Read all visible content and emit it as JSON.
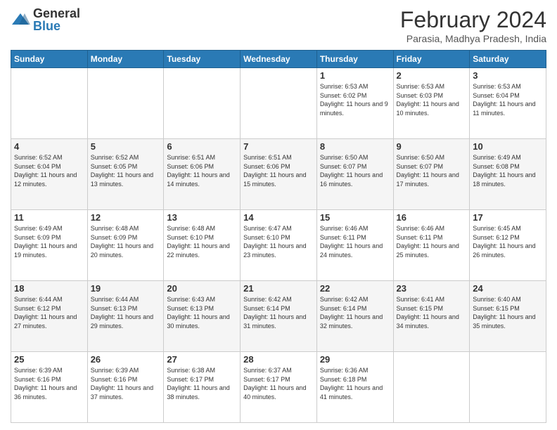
{
  "header": {
    "logo_general": "General",
    "logo_blue": "Blue",
    "month_title": "February 2024",
    "location": "Parasia, Madhya Pradesh, India"
  },
  "days_of_week": [
    "Sunday",
    "Monday",
    "Tuesday",
    "Wednesday",
    "Thursday",
    "Friday",
    "Saturday"
  ],
  "weeks": [
    [
      {
        "day": "",
        "sunrise": "",
        "sunset": "",
        "daylight": ""
      },
      {
        "day": "",
        "sunrise": "",
        "sunset": "",
        "daylight": ""
      },
      {
        "day": "",
        "sunrise": "",
        "sunset": "",
        "daylight": ""
      },
      {
        "day": "",
        "sunrise": "",
        "sunset": "",
        "daylight": ""
      },
      {
        "day": "1",
        "sunrise": "Sunrise: 6:53 AM",
        "sunset": "Sunset: 6:02 PM",
        "daylight": "Daylight: 11 hours and 9 minutes."
      },
      {
        "day": "2",
        "sunrise": "Sunrise: 6:53 AM",
        "sunset": "Sunset: 6:03 PM",
        "daylight": "Daylight: 11 hours and 10 minutes."
      },
      {
        "day": "3",
        "sunrise": "Sunrise: 6:53 AM",
        "sunset": "Sunset: 6:04 PM",
        "daylight": "Daylight: 11 hours and 11 minutes."
      }
    ],
    [
      {
        "day": "4",
        "sunrise": "Sunrise: 6:52 AM",
        "sunset": "Sunset: 6:04 PM",
        "daylight": "Daylight: 11 hours and 12 minutes."
      },
      {
        "day": "5",
        "sunrise": "Sunrise: 6:52 AM",
        "sunset": "Sunset: 6:05 PM",
        "daylight": "Daylight: 11 hours and 13 minutes."
      },
      {
        "day": "6",
        "sunrise": "Sunrise: 6:51 AM",
        "sunset": "Sunset: 6:06 PM",
        "daylight": "Daylight: 11 hours and 14 minutes."
      },
      {
        "day": "7",
        "sunrise": "Sunrise: 6:51 AM",
        "sunset": "Sunset: 6:06 PM",
        "daylight": "Daylight: 11 hours and 15 minutes."
      },
      {
        "day": "8",
        "sunrise": "Sunrise: 6:50 AM",
        "sunset": "Sunset: 6:07 PM",
        "daylight": "Daylight: 11 hours and 16 minutes."
      },
      {
        "day": "9",
        "sunrise": "Sunrise: 6:50 AM",
        "sunset": "Sunset: 6:07 PM",
        "daylight": "Daylight: 11 hours and 17 minutes."
      },
      {
        "day": "10",
        "sunrise": "Sunrise: 6:49 AM",
        "sunset": "Sunset: 6:08 PM",
        "daylight": "Daylight: 11 hours and 18 minutes."
      }
    ],
    [
      {
        "day": "11",
        "sunrise": "Sunrise: 6:49 AM",
        "sunset": "Sunset: 6:09 PM",
        "daylight": "Daylight: 11 hours and 19 minutes."
      },
      {
        "day": "12",
        "sunrise": "Sunrise: 6:48 AM",
        "sunset": "Sunset: 6:09 PM",
        "daylight": "Daylight: 11 hours and 20 minutes."
      },
      {
        "day": "13",
        "sunrise": "Sunrise: 6:48 AM",
        "sunset": "Sunset: 6:10 PM",
        "daylight": "Daylight: 11 hours and 22 minutes."
      },
      {
        "day": "14",
        "sunrise": "Sunrise: 6:47 AM",
        "sunset": "Sunset: 6:10 PM",
        "daylight": "Daylight: 11 hours and 23 minutes."
      },
      {
        "day": "15",
        "sunrise": "Sunrise: 6:46 AM",
        "sunset": "Sunset: 6:11 PM",
        "daylight": "Daylight: 11 hours and 24 minutes."
      },
      {
        "day": "16",
        "sunrise": "Sunrise: 6:46 AM",
        "sunset": "Sunset: 6:11 PM",
        "daylight": "Daylight: 11 hours and 25 minutes."
      },
      {
        "day": "17",
        "sunrise": "Sunrise: 6:45 AM",
        "sunset": "Sunset: 6:12 PM",
        "daylight": "Daylight: 11 hours and 26 minutes."
      }
    ],
    [
      {
        "day": "18",
        "sunrise": "Sunrise: 6:44 AM",
        "sunset": "Sunset: 6:12 PM",
        "daylight": "Daylight: 11 hours and 27 minutes."
      },
      {
        "day": "19",
        "sunrise": "Sunrise: 6:44 AM",
        "sunset": "Sunset: 6:13 PM",
        "daylight": "Daylight: 11 hours and 29 minutes."
      },
      {
        "day": "20",
        "sunrise": "Sunrise: 6:43 AM",
        "sunset": "Sunset: 6:13 PM",
        "daylight": "Daylight: 11 hours and 30 minutes."
      },
      {
        "day": "21",
        "sunrise": "Sunrise: 6:42 AM",
        "sunset": "Sunset: 6:14 PM",
        "daylight": "Daylight: 11 hours and 31 minutes."
      },
      {
        "day": "22",
        "sunrise": "Sunrise: 6:42 AM",
        "sunset": "Sunset: 6:14 PM",
        "daylight": "Daylight: 11 hours and 32 minutes."
      },
      {
        "day": "23",
        "sunrise": "Sunrise: 6:41 AM",
        "sunset": "Sunset: 6:15 PM",
        "daylight": "Daylight: 11 hours and 34 minutes."
      },
      {
        "day": "24",
        "sunrise": "Sunrise: 6:40 AM",
        "sunset": "Sunset: 6:15 PM",
        "daylight": "Daylight: 11 hours and 35 minutes."
      }
    ],
    [
      {
        "day": "25",
        "sunrise": "Sunrise: 6:39 AM",
        "sunset": "Sunset: 6:16 PM",
        "daylight": "Daylight: 11 hours and 36 minutes."
      },
      {
        "day": "26",
        "sunrise": "Sunrise: 6:39 AM",
        "sunset": "Sunset: 6:16 PM",
        "daylight": "Daylight: 11 hours and 37 minutes."
      },
      {
        "day": "27",
        "sunrise": "Sunrise: 6:38 AM",
        "sunset": "Sunset: 6:17 PM",
        "daylight": "Daylight: 11 hours and 38 minutes."
      },
      {
        "day": "28",
        "sunrise": "Sunrise: 6:37 AM",
        "sunset": "Sunset: 6:17 PM",
        "daylight": "Daylight: 11 hours and 40 minutes."
      },
      {
        "day": "29",
        "sunrise": "Sunrise: 6:36 AM",
        "sunset": "Sunset: 6:18 PM",
        "daylight": "Daylight: 11 hours and 41 minutes."
      },
      {
        "day": "",
        "sunrise": "",
        "sunset": "",
        "daylight": ""
      },
      {
        "day": "",
        "sunrise": "",
        "sunset": "",
        "daylight": ""
      }
    ]
  ]
}
